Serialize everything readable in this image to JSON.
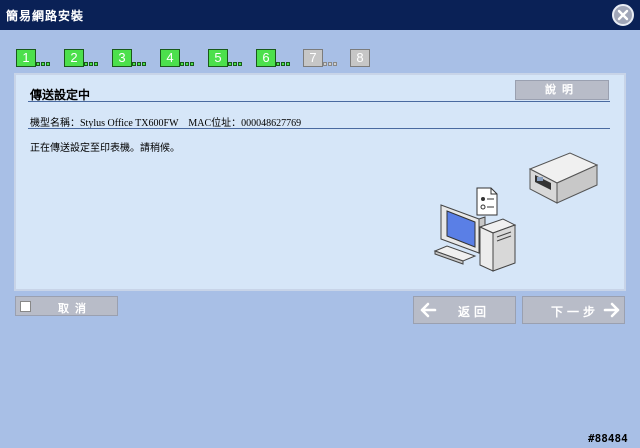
{
  "window": {
    "title": "簡易網路安裝"
  },
  "steps": [
    {
      "label": "1",
      "active": true
    },
    {
      "label": "2",
      "active": true
    },
    {
      "label": "3",
      "active": true
    },
    {
      "label": "4",
      "active": true
    },
    {
      "label": "5",
      "active": true
    },
    {
      "label": "6",
      "active": true
    },
    {
      "label": "7",
      "active": false
    },
    {
      "label": "8",
      "active": false
    }
  ],
  "panel": {
    "title": "傳送設定中",
    "help_label": "說明",
    "model_info": "機型名稱：Stylus Office TX600FW　MAC位址：000048627769",
    "message": "正在傳送設定至印表機。請稍候。"
  },
  "footer": {
    "cancel_label": "取消",
    "back_label": "返回",
    "next_label": "下一步"
  },
  "watermark": "#88484",
  "icons": [
    "close-icon",
    "printer-icon",
    "computer-icon",
    "document-icon",
    "left-arrow-icon",
    "right-arrow-icon",
    "checkbox-icon"
  ],
  "colors": {
    "titlebar": "#0a2156",
    "background": "#a8bfe6",
    "panel": "#d6e6f8",
    "step_active": "#4ce04c",
    "step_inactive": "#c6c6c6"
  }
}
